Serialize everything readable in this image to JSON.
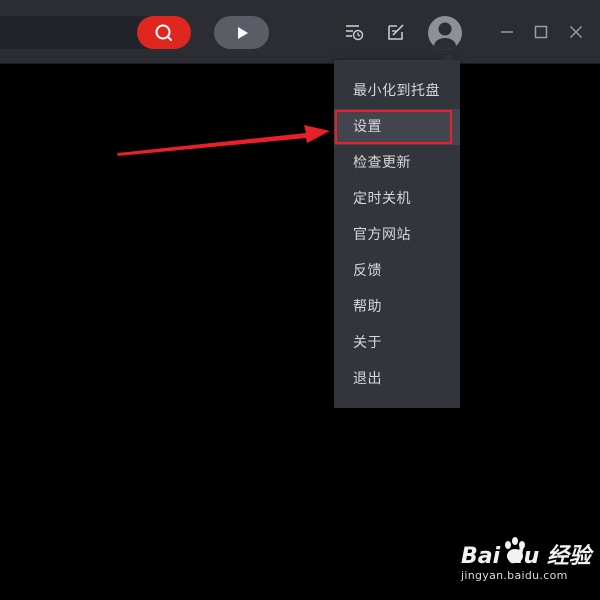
{
  "titlebar": {
    "search_icon": "search-icon",
    "play_icon": "play-icon",
    "icons": [
      "playlist-clock-icon",
      "edit-note-icon",
      "user-avatar-icon",
      "minimize-icon",
      "maximize-icon",
      "close-icon"
    ]
  },
  "menu": {
    "items": [
      {
        "label": "最小化到托盘"
      },
      {
        "label": "设置"
      },
      {
        "label": "检查更新"
      },
      {
        "label": "定时关机"
      },
      {
        "label": "官方网站"
      },
      {
        "label": "反馈"
      },
      {
        "label": "帮助"
      },
      {
        "label": "关于"
      },
      {
        "label": "退出"
      }
    ],
    "highlighted_index": 1
  },
  "annotation": {
    "arrow_color": "#e8202a",
    "box_color": "#e8202a"
  },
  "watermark": {
    "brand": "Bai du 经验",
    "url": "jingyan.baidu.com"
  },
  "colors": {
    "accent": "#e0271f",
    "titlebar": "#2b2d33",
    "menu_bg": "#33353c",
    "text": "#d6d7da"
  }
}
